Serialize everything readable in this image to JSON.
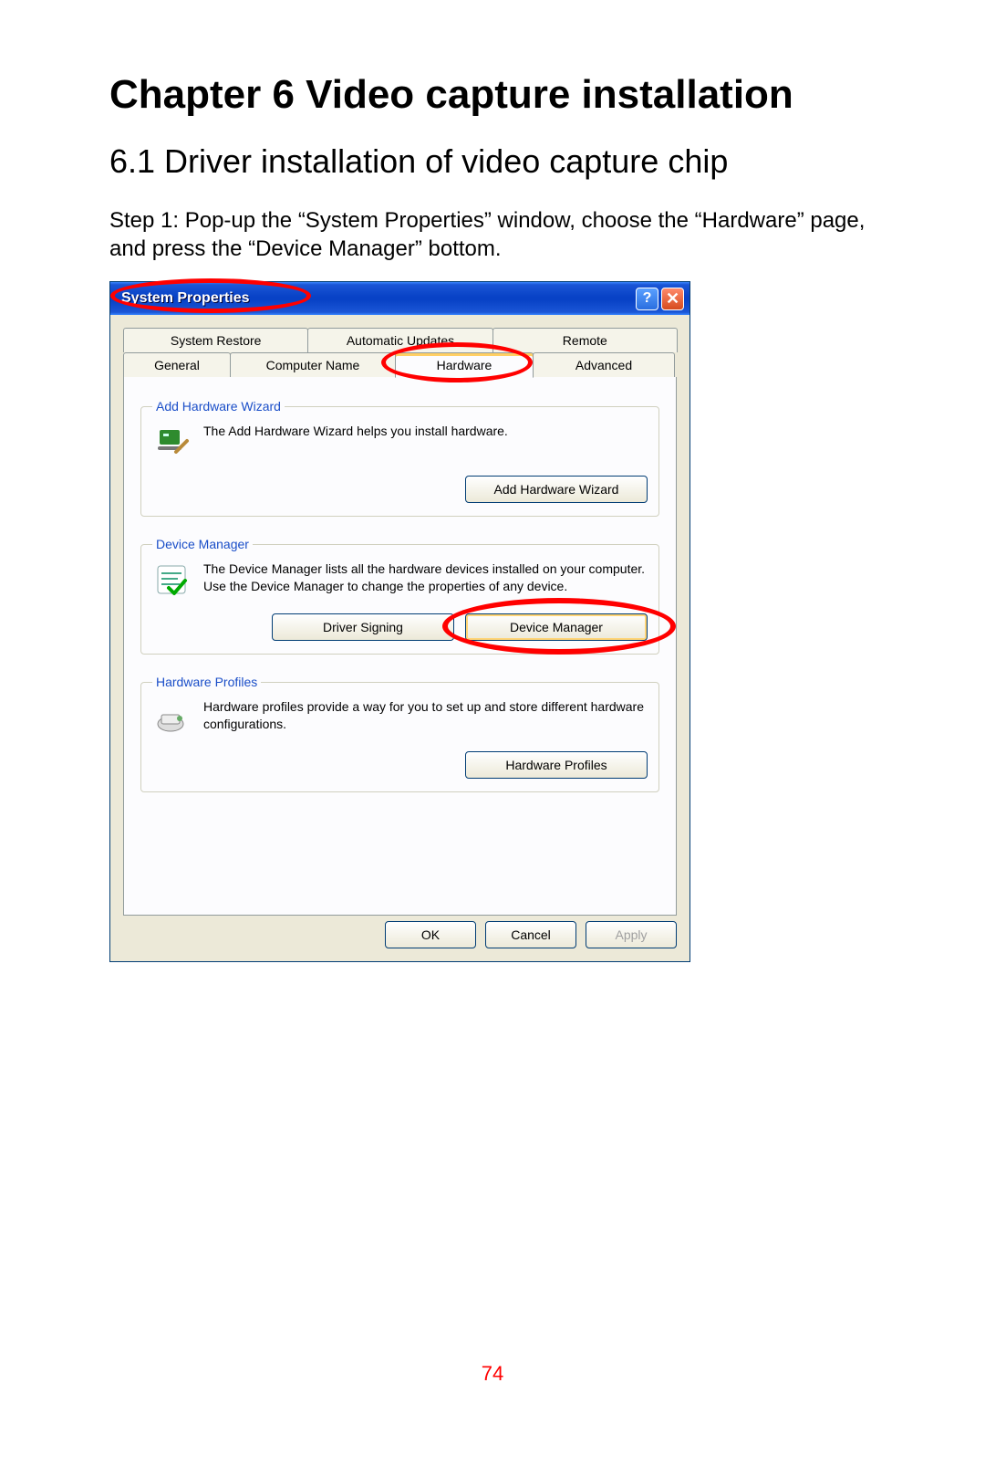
{
  "doc": {
    "chapter_title": "Chapter 6  Video capture installation",
    "section_title": "6.1 Driver installation of video capture chip",
    "step_text": "Step 1: Pop-up the “System Properties” window, choose the “Hardware” page, and press the “Device Manager” bottom.",
    "page_number": "74"
  },
  "dialog": {
    "title": "System Properties",
    "tabs_row1": [
      "System Restore",
      "Automatic Updates",
      "Remote"
    ],
    "tabs_row2": [
      "General",
      "Computer Name",
      "Hardware",
      "Advanced"
    ],
    "active_tab": "Hardware",
    "groups": {
      "add_hardware": {
        "legend": "Add Hardware Wizard",
        "text": "The Add Hardware Wizard helps you install hardware.",
        "button": "Add Hardware Wizard"
      },
      "device_manager": {
        "legend": "Device Manager",
        "text": "The Device Manager lists all the hardware devices installed on your computer. Use the Device Manager to change the properties of any device.",
        "button_left": "Driver Signing",
        "button_right": "Device Manager"
      },
      "hardware_profiles": {
        "legend": "Hardware Profiles",
        "text": "Hardware profiles provide a way for you to set up and store different hardware configurations.",
        "button": "Hardware Profiles"
      }
    },
    "footer": {
      "ok": "OK",
      "cancel": "Cancel",
      "apply": "Apply"
    }
  },
  "annotations": {
    "circled": [
      "title",
      "Hardware tab",
      "Device Manager button"
    ]
  }
}
